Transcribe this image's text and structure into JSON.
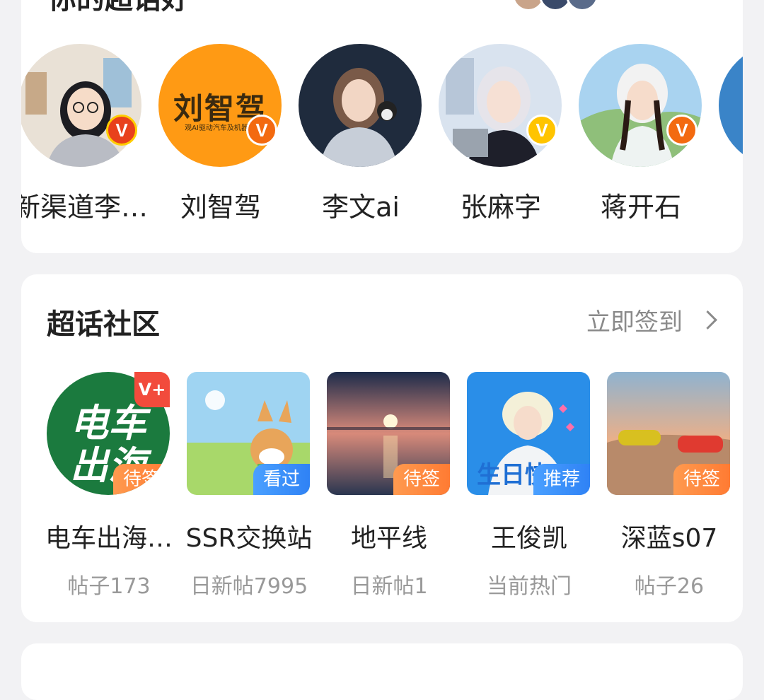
{
  "people_section": {
    "title": "你的超话好",
    "people": [
      {
        "name": "新渠道李…",
        "badge": "V",
        "badge_color": "red"
      },
      {
        "name": "刘智驾",
        "badge": "V",
        "badge_color": "orange",
        "logo_main": "刘智驾",
        "logo_sub": "观AI驱动汽车及机器人"
      },
      {
        "name": "李文ai"
      },
      {
        "name": "张麻字",
        "badge": "V",
        "badge_color": "yellow"
      },
      {
        "name": "蒋开石",
        "badge": "V",
        "badge_color": "orange"
      }
    ]
  },
  "super_topics": {
    "title": "超话社区",
    "action_label": "立即签到",
    "topics": [
      {
        "name": "电车出海…",
        "subtitle": "帖子173",
        "tag": "待签",
        "tag_color": "orange",
        "corner": "V+",
        "art_line1": "电车",
        "art_line2": "出海"
      },
      {
        "name": "SSR交换站",
        "subtitle": "日新帖7995",
        "tag": "看过",
        "tag_color": "blue"
      },
      {
        "name": "地平线",
        "subtitle": "日新帖1",
        "tag": "待签",
        "tag_color": "orange"
      },
      {
        "name": "王俊凯",
        "subtitle": "当前热门",
        "tag": "推荐",
        "tag_color": "blue",
        "art_text": "生日快"
      },
      {
        "name": "深蓝s07",
        "subtitle": "帖子26",
        "tag": "待签",
        "tag_color": "orange"
      }
    ]
  },
  "colors": {
    "page_bg": "#f2f2f4",
    "card_bg": "#ffffff",
    "tag_orange": "#ff8a3d",
    "tag_blue": "#3b8ff7",
    "muted_text": "#8a8a8a"
  }
}
